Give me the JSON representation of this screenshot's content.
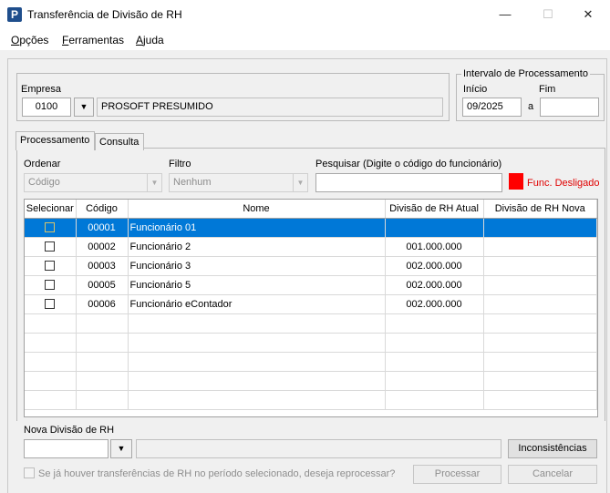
{
  "window": {
    "title": "Transferência de Divisão de RH",
    "minimize_glyph": "—",
    "maximize_glyph": "☐",
    "close_glyph": "✕",
    "app_icon_letter": "P"
  },
  "menu": {
    "items": [
      {
        "accel": "O",
        "rest": "pções"
      },
      {
        "accel": "F",
        "rest": "erramentas"
      },
      {
        "accel": "A",
        "rest": "juda"
      }
    ]
  },
  "empresa": {
    "label": "Empresa",
    "code": "0100",
    "name": "PROSOFT PRESUMIDO"
  },
  "intervalo": {
    "label": "Intervalo de Processamento",
    "inicio_label": "Início",
    "fim_label": "Fim",
    "inicio_value": "09/2025",
    "separator": "a",
    "fim_value": ""
  },
  "tabs": [
    {
      "label": "Processamento",
      "active": true
    },
    {
      "label": "Consulta",
      "active": false
    }
  ],
  "filters": {
    "ordenar_label": "Ordenar",
    "ordenar_value": "Código",
    "filtro_label": "Filtro",
    "filtro_value": "Nenhum",
    "pesquisar_label": "Pesquisar (Digite o código do funcionário)",
    "pesquisar_value": "",
    "legend_color": "#ff0000",
    "legend_text": "Func. Desligado"
  },
  "grid": {
    "columns": [
      "Selecionar",
      "Código",
      "Nome",
      "Divisão de RH Atual",
      "Divisão de RH Nova"
    ],
    "rows": [
      {
        "codigo": "00001",
        "nome": "Funcionário 01",
        "atual": "",
        "nova": "",
        "selected": true
      },
      {
        "codigo": "00002",
        "nome": "Funcionário 2",
        "atual": "001.000.000",
        "nova": "",
        "selected": false
      },
      {
        "codigo": "00003",
        "nome": "Funcionário 3",
        "atual": "002.000.000",
        "nova": "",
        "selected": false
      },
      {
        "codigo": "00005",
        "nome": "Funcionário 5",
        "atual": "002.000.000",
        "nova": "",
        "selected": false
      },
      {
        "codigo": "00006",
        "nome": "Funcionário eContador",
        "atual": "002.000.000",
        "nova": "",
        "selected": false
      }
    ],
    "empty_rows": 5
  },
  "nova_divisao": {
    "label": "Nova Divisão de RH",
    "value": "",
    "description": ""
  },
  "buttons": {
    "inconsistencias": "Inconsistências",
    "processar": "Processar",
    "cancelar": "Cancelar"
  },
  "reprocess": {
    "label": "Se já houver transferências de RH no período selecionado, deseja reprocessar?",
    "checked": false
  },
  "colors": {
    "selection": "#0078d7",
    "accent": "#1f4e8c"
  }
}
